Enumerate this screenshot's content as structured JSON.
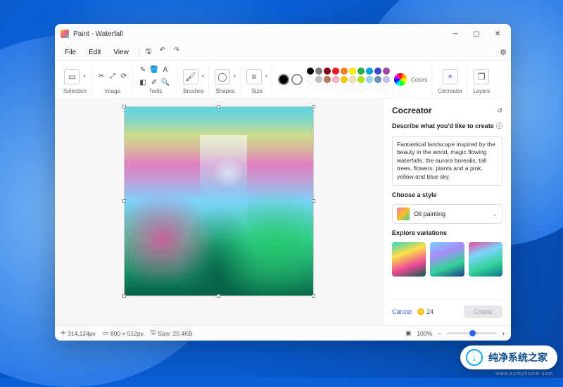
{
  "app": {
    "title": "Paint - Waterfall"
  },
  "menu": {
    "file": "File",
    "edit": "Edit",
    "view": "View"
  },
  "ribbon": {
    "selection": "Selection",
    "image": "Image",
    "tools": "Tools",
    "brushes": "Brushes",
    "shapes": "Shapes",
    "size": "Size",
    "colors": "Colors",
    "cocreator": "Cocreator",
    "layers": "Layers"
  },
  "palette": {
    "row1": [
      "#000000",
      "#7f7f7f",
      "#880015",
      "#ed1c24",
      "#ff7f27",
      "#fff200",
      "#22b14c",
      "#00a2e8",
      "#3f48cc",
      "#a349a4"
    ],
    "row2": [
      "#ffffff",
      "#c3c3c3",
      "#b97a57",
      "#ffaec9",
      "#ffc90e",
      "#efe4b0",
      "#b5e61d",
      "#99d9ea",
      "#7092be",
      "#c8bfe7"
    ],
    "row3": [
      "#ffffff",
      "#ffffff",
      "#ffffff",
      "#ffffff",
      "#ffffff",
      "#ffffff",
      "#ffffff",
      "#ffffff",
      "#ffffff",
      "#ffffff"
    ]
  },
  "cocreator": {
    "title": "Cocreator",
    "describe_label": "Describe what you'd like to create",
    "prompt": "Fantastical landscape inspired by the beauty in the world, magic flowing waterfalls, the aurora borealis, tall trees, flowers, plants and a pink, yellow and blue sky.",
    "style_label": "Choose a style",
    "style_value": "Oil painting",
    "variations_label": "Explore variations",
    "cancel": "Cancel",
    "credits": "24",
    "create": "Create"
  },
  "status": {
    "cursor": "314,124px",
    "canvas_size": "800 × 512px",
    "file_size": "Size: 20.4KB",
    "zoom": "100%"
  },
  "watermark": {
    "text": "纯净系统之家",
    "url": "www.kzmyhome.com"
  }
}
